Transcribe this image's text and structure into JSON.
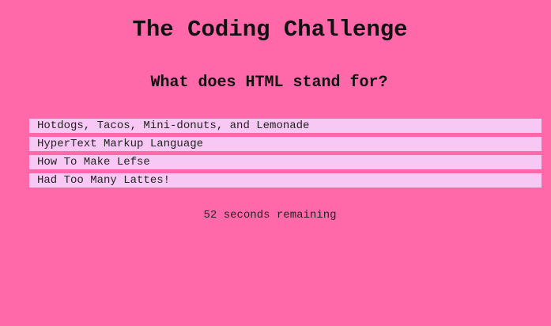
{
  "colors": {
    "background": "#ff69aa",
    "answer_background": "#f8c8f5",
    "text": "#111111"
  },
  "header": {
    "title": "The Coding Challenge"
  },
  "quiz": {
    "question": "What does HTML stand for?",
    "answers": [
      "Hotdogs, Tacos, Mini-donuts, and Lemonade",
      "HyperText Markup Language",
      "How To Make Lefse",
      "Had Too Many Lattes!"
    ]
  },
  "timer": {
    "text": "52 seconds remaining"
  }
}
